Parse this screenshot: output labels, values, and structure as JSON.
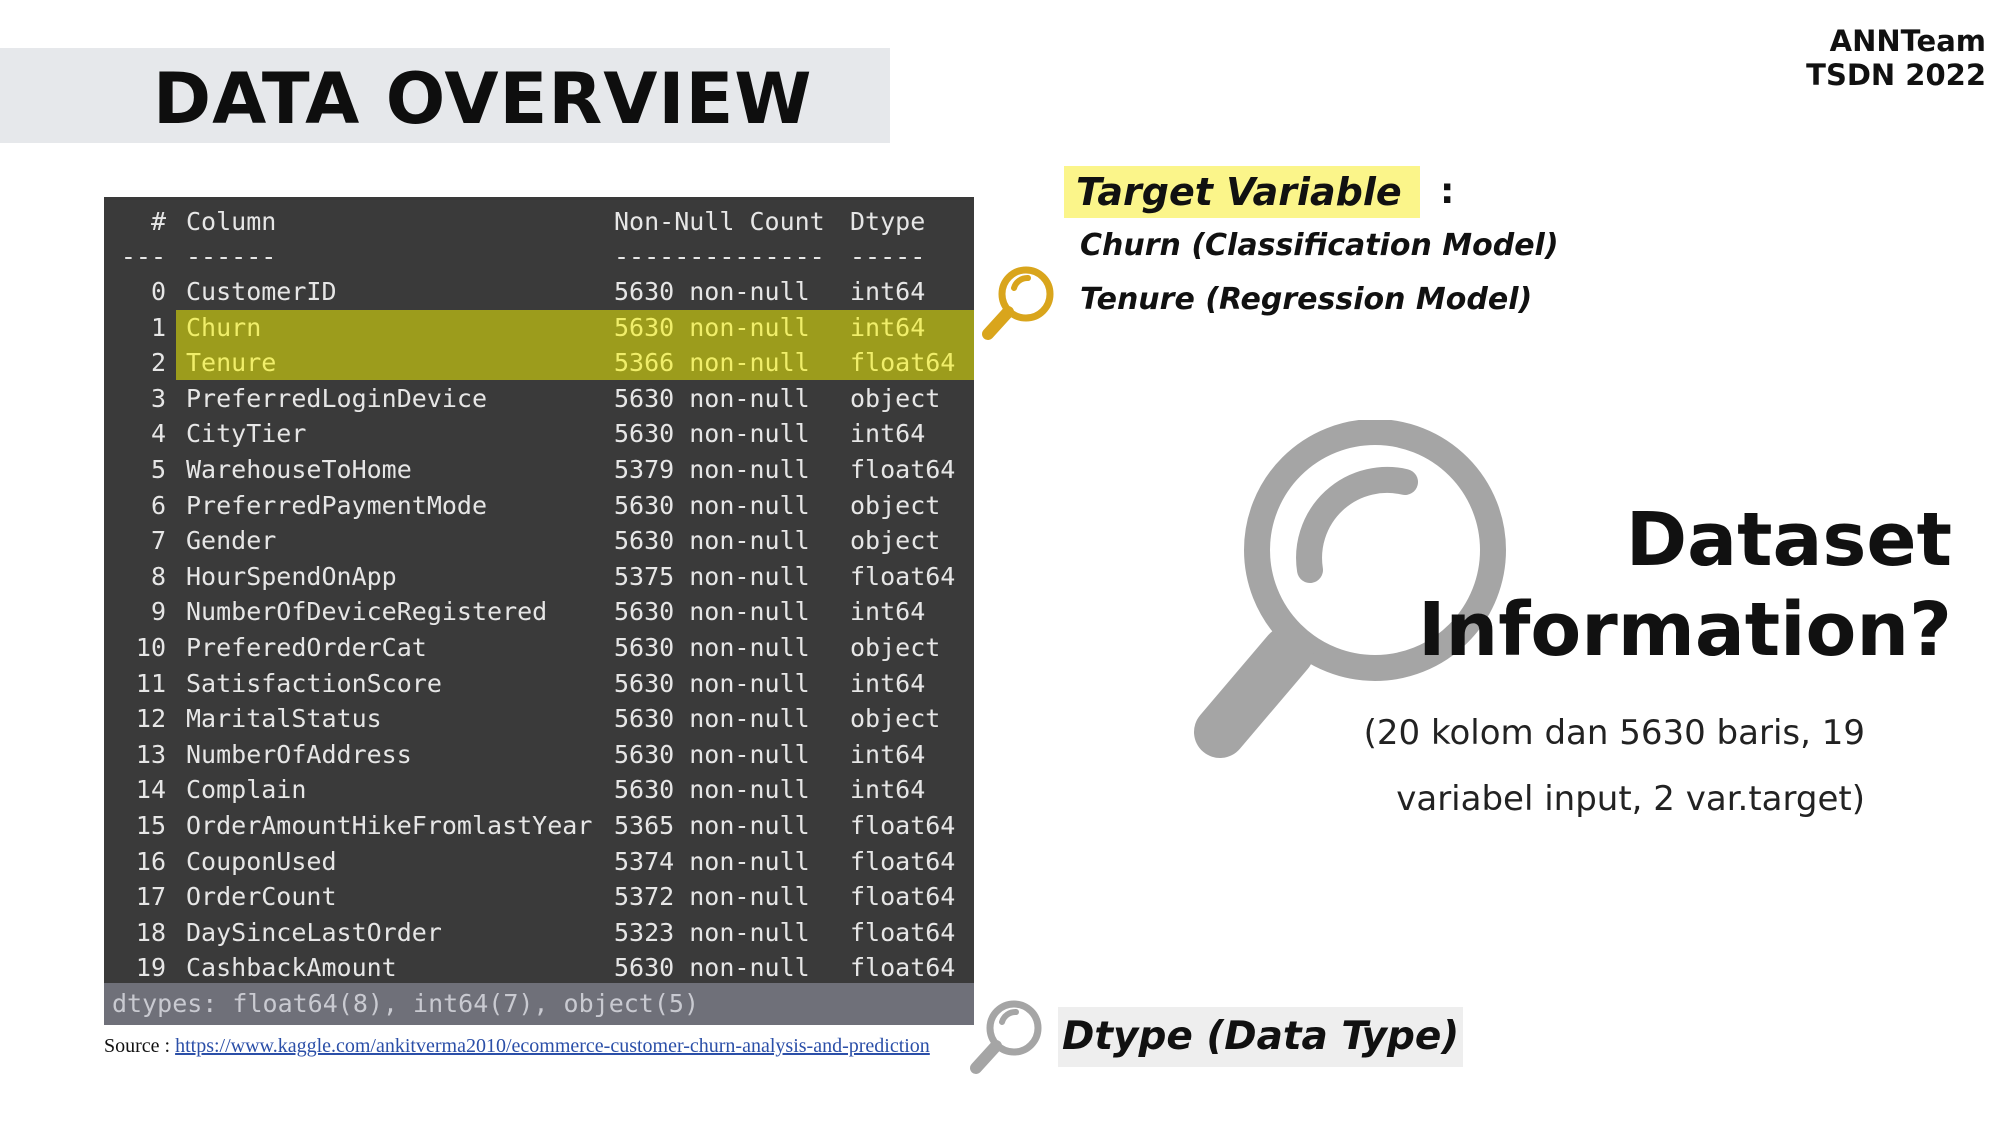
{
  "slide": {
    "title": "DATA OVERVIEW",
    "brand": {
      "line1": "ANNTeam",
      "line2": "TSDN 2022"
    }
  },
  "df_info": {
    "header": {
      "idx": "#",
      "column": "Column",
      "count": "Non-Null Count",
      "dtype": "Dtype"
    },
    "separator": {
      "idx": "---",
      "column": "------",
      "count": "--------------",
      "dtype": "-----"
    },
    "rows": [
      {
        "idx": "0",
        "column": "CustomerID",
        "count": "5630 non-null",
        "dtype": "int64"
      },
      {
        "idx": "1",
        "column": "Churn",
        "count": "5630 non-null",
        "dtype": "int64"
      },
      {
        "idx": "2",
        "column": "Tenure",
        "count": "5366 non-null",
        "dtype": "float64"
      },
      {
        "idx": "3",
        "column": "PreferredLoginDevice",
        "count": "5630 non-null",
        "dtype": "object"
      },
      {
        "idx": "4",
        "column": "CityTier",
        "count": "5630 non-null",
        "dtype": "int64"
      },
      {
        "idx": "5",
        "column": "WarehouseToHome",
        "count": "5379 non-null",
        "dtype": "float64"
      },
      {
        "idx": "6",
        "column": "PreferredPaymentMode",
        "count": "5630 non-null",
        "dtype": "object"
      },
      {
        "idx": "7",
        "column": "Gender",
        "count": "5630 non-null",
        "dtype": "object"
      },
      {
        "idx": "8",
        "column": "HourSpendOnApp",
        "count": "5375 non-null",
        "dtype": "float64"
      },
      {
        "idx": "9",
        "column": "NumberOfDeviceRegistered",
        "count": "5630 non-null",
        "dtype": "int64"
      },
      {
        "idx": "10",
        "column": "PreferedOrderCat",
        "count": "5630 non-null",
        "dtype": "object"
      },
      {
        "idx": "11",
        "column": "SatisfactionScore",
        "count": "5630 non-null",
        "dtype": "int64"
      },
      {
        "idx": "12",
        "column": "MaritalStatus",
        "count": "5630 non-null",
        "dtype": "object"
      },
      {
        "idx": "13",
        "column": "NumberOfAddress",
        "count": "5630 non-null",
        "dtype": "int64"
      },
      {
        "idx": "14",
        "column": "Complain",
        "count": "5630 non-null",
        "dtype": "int64"
      },
      {
        "idx": "15",
        "column": "OrderAmountHikeFromlastYear",
        "count": "5365 non-null",
        "dtype": "float64"
      },
      {
        "idx": "16",
        "column": "CouponUsed",
        "count": "5374 non-null",
        "dtype": "float64"
      },
      {
        "idx": "17",
        "column": "OrderCount",
        "count": "5372 non-null",
        "dtype": "float64"
      },
      {
        "idx": "18",
        "column": "DaySinceLastOrder",
        "count": "5323 non-null",
        "dtype": "float64"
      },
      {
        "idx": "19",
        "column": "CashbackAmount",
        "count": "5630 non-null",
        "dtype": "float64"
      }
    ],
    "highlighted_rows": [
      1,
      2
    ],
    "footer": "dtypes: float64(8), int64(7), object(5)",
    "colors": {
      "background": "#3a3a3a",
      "highlight": "#9c9c1c",
      "highlight_text": "#f0ee6a",
      "footer": "#6f7079"
    }
  },
  "source": {
    "label": "Source : ",
    "link": "https://www.kaggle.com/ankitverma2010/ecommerce-customer-churn-analysis-and-prediction"
  },
  "target": {
    "title": "Target Variable",
    "colon": ":",
    "line1": "Churn (Classification Model)",
    "line2": "Tenure (Regression Model)",
    "highlight_color": "#fbf58a"
  },
  "dataset": {
    "title_line1": "Dataset",
    "title_line2": "Information?",
    "sub_line1": "(20 kolom dan 5630 baris, 19",
    "sub_line2": "variabel input, 2 var.target)"
  },
  "dtype_note": {
    "label": "Dtype (Data Type)"
  },
  "icons": {
    "small_magnifier_target": "magnifier-icon",
    "large_magnifier": "magnifier-icon",
    "small_magnifier_dtype": "magnifier-icon",
    "colors": {
      "gold": "#d9a51c",
      "gray": "#a5a5a5"
    }
  }
}
